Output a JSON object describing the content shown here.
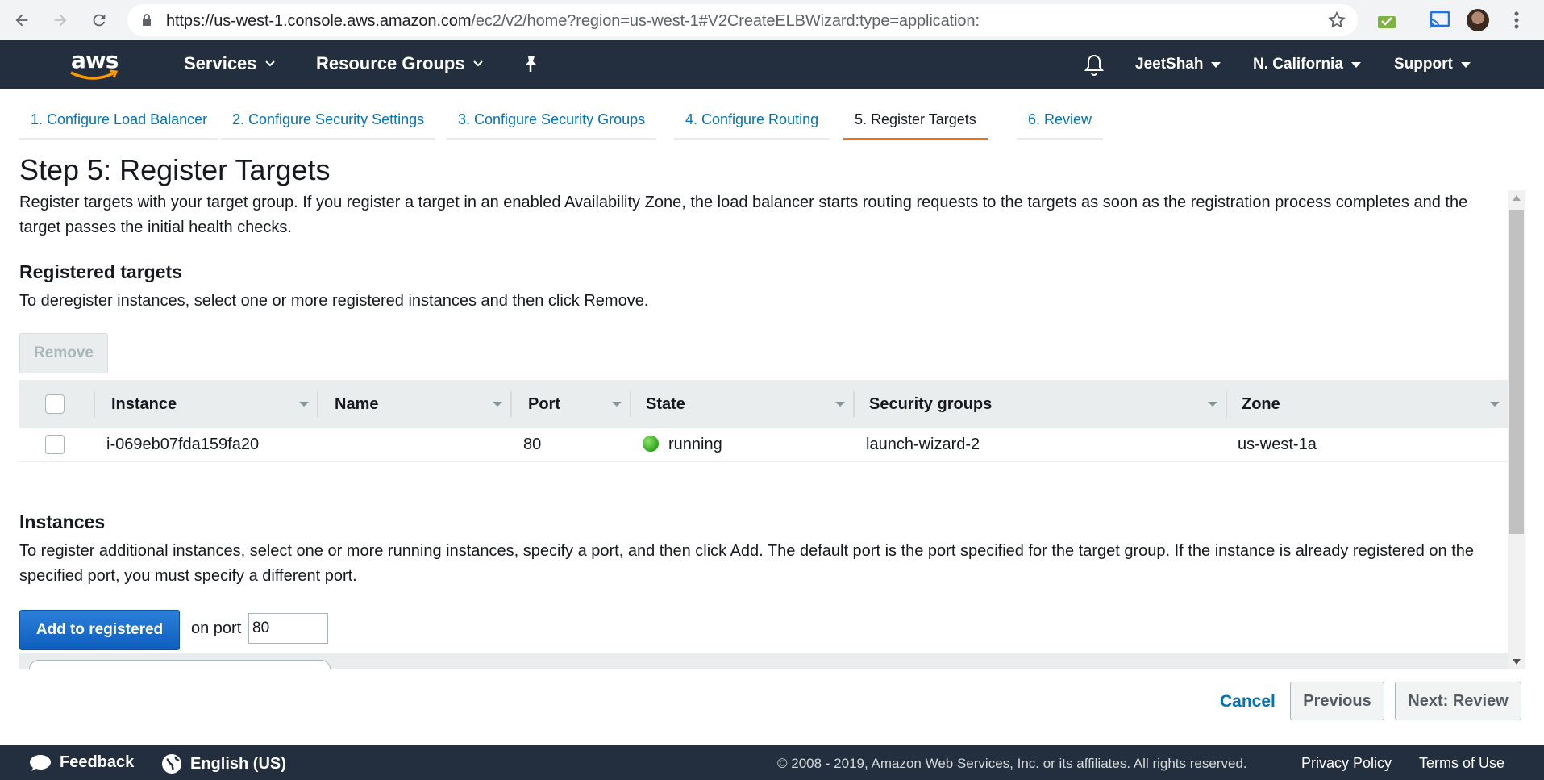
{
  "browser": {
    "url_host": "https://us-west-1.console.aws.amazon.com",
    "url_path": "/ec2/v2/home?region=us-west-1#V2CreateELBWizard:type=application:"
  },
  "aws_nav": {
    "logo_text": "aws",
    "services": "Services",
    "resource_groups": "Resource Groups",
    "user": "JeetShah",
    "region": "N. California",
    "support": "Support",
    "icons": [
      "bell-icon",
      "pin-icon"
    ]
  },
  "wizard": {
    "tabs": [
      {
        "label": "1. Configure Load Balancer",
        "active": false
      },
      {
        "label": "2. Configure Security Settings",
        "active": false
      },
      {
        "label": "3. Configure Security Groups",
        "active": false
      },
      {
        "label": "4. Configure Routing",
        "active": false
      },
      {
        "label": "5. Register Targets",
        "active": true
      },
      {
        "label": "6. Review",
        "active": false
      }
    ],
    "title": "Step 5: Register Targets",
    "intro": "Register targets with your target group. If you register a target in an enabled Availability Zone, the load balancer starts routing requests to the targets as soon as the registration process completes and the target passes the initial health checks."
  },
  "registered": {
    "heading": "Registered targets",
    "description": "To deregister instances, select one or more registered instances and then click Remove.",
    "remove_label": "Remove",
    "columns": [
      "Instance",
      "Name",
      "Port",
      "State",
      "Security groups",
      "Zone"
    ],
    "rows": [
      {
        "instance": "i-069eb07fda159fa20",
        "name": "",
        "port": "80",
        "state": "running",
        "security_groups": "launch-wizard-2",
        "zone": "us-west-1a"
      }
    ]
  },
  "instances": {
    "heading": "Instances",
    "description": "To register additional instances, select one or more running instances, specify a port, and then click Add. The default port is the port specified for the target group. If the instance is already registered on the specified port, you must specify a different port.",
    "add_label": "Add to registered",
    "on_port_label": "on port",
    "port_value": "80"
  },
  "actions": {
    "cancel": "Cancel",
    "previous": "Previous",
    "next": "Next: Review"
  },
  "footer": {
    "feedback": "Feedback",
    "language": "English (US)",
    "copyright": "© 2008 - 2019, Amazon Web Services, Inc. or its affiliates. All rights reserved.",
    "privacy": "Privacy Policy",
    "terms": "Terms of Use"
  },
  "colors": {
    "aws_nav_bg": "#232f3e",
    "active_tab": "#ec7211",
    "link": "#0073bb",
    "primary_button": "#0c6cd0",
    "running": "#2ea41b"
  }
}
